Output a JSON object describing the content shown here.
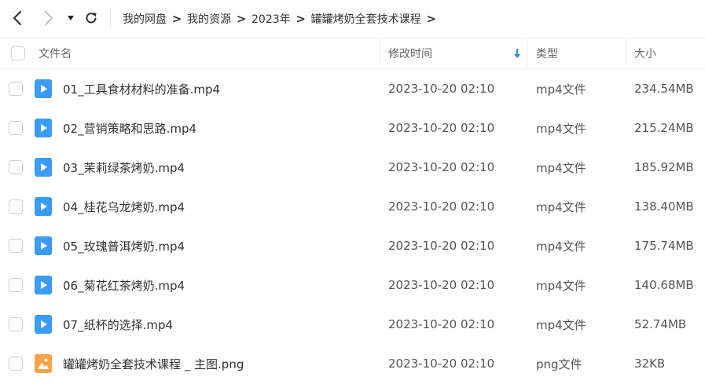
{
  "nav": {
    "back_icon": "chevron-left-icon",
    "forward_icon": "chevron-right-icon",
    "dropdown_icon": "caret-down-icon",
    "refresh_icon": "refresh-icon",
    "separator": ">",
    "breadcrumb": [
      "我的网盘",
      "我的资源",
      "2023年",
      "罐罐烤奶全套技术课程"
    ]
  },
  "header": {
    "name": "文件名",
    "mtime": "修改时间",
    "type": "类型",
    "size": "大小",
    "sort_icon": "sort-down-arrow-icon"
  },
  "colors": {
    "video_icon": "#3b9cf3",
    "image_icon": "#f8a24a",
    "sort_arrow": "#2f86f6"
  },
  "files": [
    {
      "name": "01_工具食材材料的准备.mp4",
      "mtime": "2023-10-20 02:10",
      "type": "mp4文件",
      "size": "234.54MB",
      "icon": "video-file-icon"
    },
    {
      "name": "02_营销策略和思路.mp4",
      "mtime": "2023-10-20 02:10",
      "type": "mp4文件",
      "size": "215.24MB",
      "icon": "video-file-icon"
    },
    {
      "name": "03_茉莉绿茶烤奶.mp4",
      "mtime": "2023-10-20 02:10",
      "type": "mp4文件",
      "size": "185.92MB",
      "icon": "video-file-icon"
    },
    {
      "name": "04_桂花乌龙烤奶.mp4",
      "mtime": "2023-10-20 02:10",
      "type": "mp4文件",
      "size": "138.40MB",
      "icon": "video-file-icon"
    },
    {
      "name": "05_玫瑰普洱烤奶.mp4",
      "mtime": "2023-10-20 02:10",
      "type": "mp4文件",
      "size": "175.74MB",
      "icon": "video-file-icon"
    },
    {
      "name": "06_菊花红茶烤奶.mp4",
      "mtime": "2023-10-20 02:10",
      "type": "mp4文件",
      "size": "140.68MB",
      "icon": "video-file-icon"
    },
    {
      "name": "07_纸杯的选择.mp4",
      "mtime": "2023-10-20 02:10",
      "type": "mp4文件",
      "size": "52.74MB",
      "icon": "video-file-icon"
    },
    {
      "name": "罐罐烤奶全套技术课程 _ 主图.png",
      "mtime": "2023-10-20 02:10",
      "type": "png文件",
      "size": "32KB",
      "icon": "image-file-icon"
    }
  ]
}
